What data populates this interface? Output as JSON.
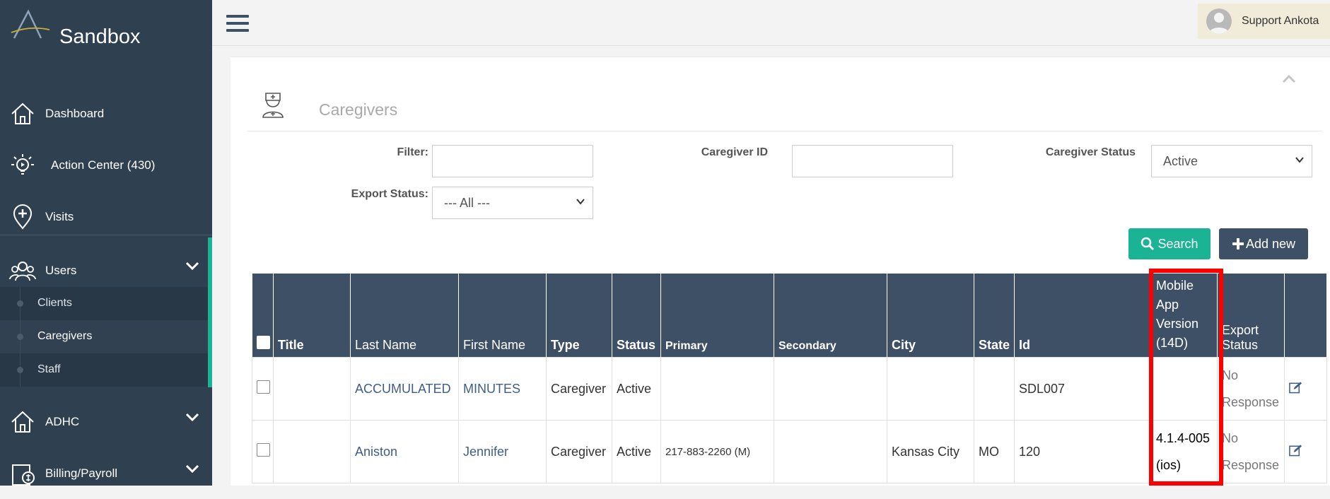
{
  "brand": {
    "name": "Sandbox"
  },
  "sidebar": {
    "items": [
      {
        "label": "Dashboard",
        "icon": "home-icon"
      },
      {
        "label": "Action Center (430)",
        "icon": "lightbulb-icon"
      },
      {
        "label": "Visits",
        "icon": "location-plus-icon"
      },
      {
        "label": "Users",
        "icon": "users-icon"
      },
      {
        "label": "ADHC",
        "icon": "home-icon"
      },
      {
        "label": "Billing/Payroll",
        "icon": "billing-icon"
      }
    ],
    "users_sub": [
      {
        "label": "Clients"
      },
      {
        "label": "Caregivers"
      },
      {
        "label": "Staff"
      }
    ]
  },
  "header": {
    "user_name": "Support Ankota"
  },
  "panel": {
    "title": "Caregivers"
  },
  "filters": {
    "filter_label": "Filter:",
    "filter_value": "",
    "caregiver_id_label": "Caregiver ID",
    "caregiver_id_value": "",
    "caregiver_status_label": "Caregiver Status",
    "caregiver_status_value": "Active",
    "export_status_label": "Export Status:",
    "export_status_value": "--- All ---"
  },
  "buttons": {
    "search": "Search",
    "add_new": "Add new"
  },
  "table": {
    "columns": [
      "Title",
      "Last Name",
      "First Name",
      "Type",
      "Status",
      "Primary",
      "Secondary",
      "City",
      "State",
      "Id",
      "Mobile App Version (14D)",
      "Export Status"
    ],
    "rows": [
      {
        "title": "",
        "last_name": "ACCUMULATED",
        "first_name": "MINUTES",
        "type": "Caregiver",
        "status": "Active",
        "primary": "",
        "secondary": "",
        "city": "",
        "state": "",
        "id": "SDL007",
        "app_version": "",
        "export_status": "No Response"
      },
      {
        "title": "",
        "last_name": "Aniston",
        "first_name": "Jennifer",
        "type": "Caregiver",
        "status": "Active",
        "primary": "217-883-2260 (M)",
        "secondary": "",
        "city": "Kansas City",
        "state": "MO",
        "id": "120",
        "app_version": "4.1.4-005 (ios)",
        "export_status": "No Response"
      }
    ]
  },
  "colors": {
    "sidebar_bg": "#2f4050",
    "accent": "#1ab394",
    "header_bg": "#3e5066",
    "highlight": "#ff0000"
  }
}
